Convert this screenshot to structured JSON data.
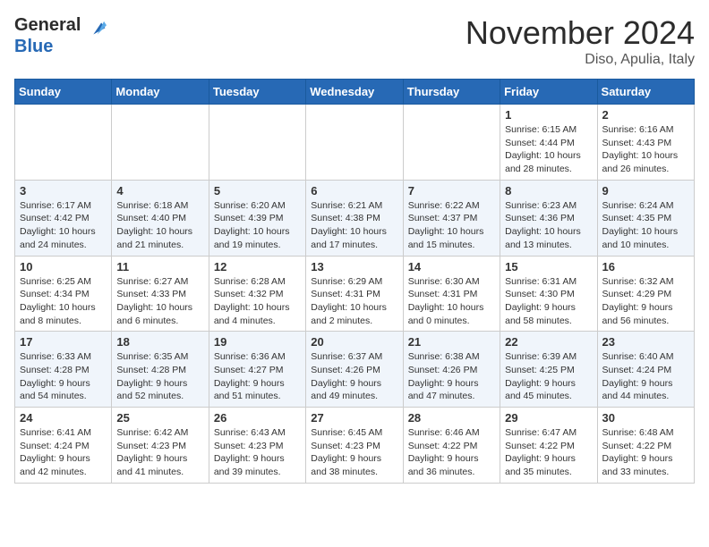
{
  "header": {
    "logo_line1": "General",
    "logo_line2": "Blue",
    "month": "November 2024",
    "location": "Diso, Apulia, Italy"
  },
  "weekdays": [
    "Sunday",
    "Monday",
    "Tuesday",
    "Wednesday",
    "Thursday",
    "Friday",
    "Saturday"
  ],
  "weeks": [
    [
      {
        "day": "",
        "info": ""
      },
      {
        "day": "",
        "info": ""
      },
      {
        "day": "",
        "info": ""
      },
      {
        "day": "",
        "info": ""
      },
      {
        "day": "",
        "info": ""
      },
      {
        "day": "1",
        "info": "Sunrise: 6:15 AM\nSunset: 4:44 PM\nDaylight: 10 hours and 28 minutes."
      },
      {
        "day": "2",
        "info": "Sunrise: 6:16 AM\nSunset: 4:43 PM\nDaylight: 10 hours and 26 minutes."
      }
    ],
    [
      {
        "day": "3",
        "info": "Sunrise: 6:17 AM\nSunset: 4:42 PM\nDaylight: 10 hours and 24 minutes."
      },
      {
        "day": "4",
        "info": "Sunrise: 6:18 AM\nSunset: 4:40 PM\nDaylight: 10 hours and 21 minutes."
      },
      {
        "day": "5",
        "info": "Sunrise: 6:20 AM\nSunset: 4:39 PM\nDaylight: 10 hours and 19 minutes."
      },
      {
        "day": "6",
        "info": "Sunrise: 6:21 AM\nSunset: 4:38 PM\nDaylight: 10 hours and 17 minutes."
      },
      {
        "day": "7",
        "info": "Sunrise: 6:22 AM\nSunset: 4:37 PM\nDaylight: 10 hours and 15 minutes."
      },
      {
        "day": "8",
        "info": "Sunrise: 6:23 AM\nSunset: 4:36 PM\nDaylight: 10 hours and 13 minutes."
      },
      {
        "day": "9",
        "info": "Sunrise: 6:24 AM\nSunset: 4:35 PM\nDaylight: 10 hours and 10 minutes."
      }
    ],
    [
      {
        "day": "10",
        "info": "Sunrise: 6:25 AM\nSunset: 4:34 PM\nDaylight: 10 hours and 8 minutes."
      },
      {
        "day": "11",
        "info": "Sunrise: 6:27 AM\nSunset: 4:33 PM\nDaylight: 10 hours and 6 minutes."
      },
      {
        "day": "12",
        "info": "Sunrise: 6:28 AM\nSunset: 4:32 PM\nDaylight: 10 hours and 4 minutes."
      },
      {
        "day": "13",
        "info": "Sunrise: 6:29 AM\nSunset: 4:31 PM\nDaylight: 10 hours and 2 minutes."
      },
      {
        "day": "14",
        "info": "Sunrise: 6:30 AM\nSunset: 4:31 PM\nDaylight: 10 hours and 0 minutes."
      },
      {
        "day": "15",
        "info": "Sunrise: 6:31 AM\nSunset: 4:30 PM\nDaylight: 9 hours and 58 minutes."
      },
      {
        "day": "16",
        "info": "Sunrise: 6:32 AM\nSunset: 4:29 PM\nDaylight: 9 hours and 56 minutes."
      }
    ],
    [
      {
        "day": "17",
        "info": "Sunrise: 6:33 AM\nSunset: 4:28 PM\nDaylight: 9 hours and 54 minutes."
      },
      {
        "day": "18",
        "info": "Sunrise: 6:35 AM\nSunset: 4:28 PM\nDaylight: 9 hours and 52 minutes."
      },
      {
        "day": "19",
        "info": "Sunrise: 6:36 AM\nSunset: 4:27 PM\nDaylight: 9 hours and 51 minutes."
      },
      {
        "day": "20",
        "info": "Sunrise: 6:37 AM\nSunset: 4:26 PM\nDaylight: 9 hours and 49 minutes."
      },
      {
        "day": "21",
        "info": "Sunrise: 6:38 AM\nSunset: 4:26 PM\nDaylight: 9 hours and 47 minutes."
      },
      {
        "day": "22",
        "info": "Sunrise: 6:39 AM\nSunset: 4:25 PM\nDaylight: 9 hours and 45 minutes."
      },
      {
        "day": "23",
        "info": "Sunrise: 6:40 AM\nSunset: 4:24 PM\nDaylight: 9 hours and 44 minutes."
      }
    ],
    [
      {
        "day": "24",
        "info": "Sunrise: 6:41 AM\nSunset: 4:24 PM\nDaylight: 9 hours and 42 minutes."
      },
      {
        "day": "25",
        "info": "Sunrise: 6:42 AM\nSunset: 4:23 PM\nDaylight: 9 hours and 41 minutes."
      },
      {
        "day": "26",
        "info": "Sunrise: 6:43 AM\nSunset: 4:23 PM\nDaylight: 9 hours and 39 minutes."
      },
      {
        "day": "27",
        "info": "Sunrise: 6:45 AM\nSunset: 4:23 PM\nDaylight: 9 hours and 38 minutes."
      },
      {
        "day": "28",
        "info": "Sunrise: 6:46 AM\nSunset: 4:22 PM\nDaylight: 9 hours and 36 minutes."
      },
      {
        "day": "29",
        "info": "Sunrise: 6:47 AM\nSunset: 4:22 PM\nDaylight: 9 hours and 35 minutes."
      },
      {
        "day": "30",
        "info": "Sunrise: 6:48 AM\nSunset: 4:22 PM\nDaylight: 9 hours and 33 minutes."
      }
    ]
  ]
}
